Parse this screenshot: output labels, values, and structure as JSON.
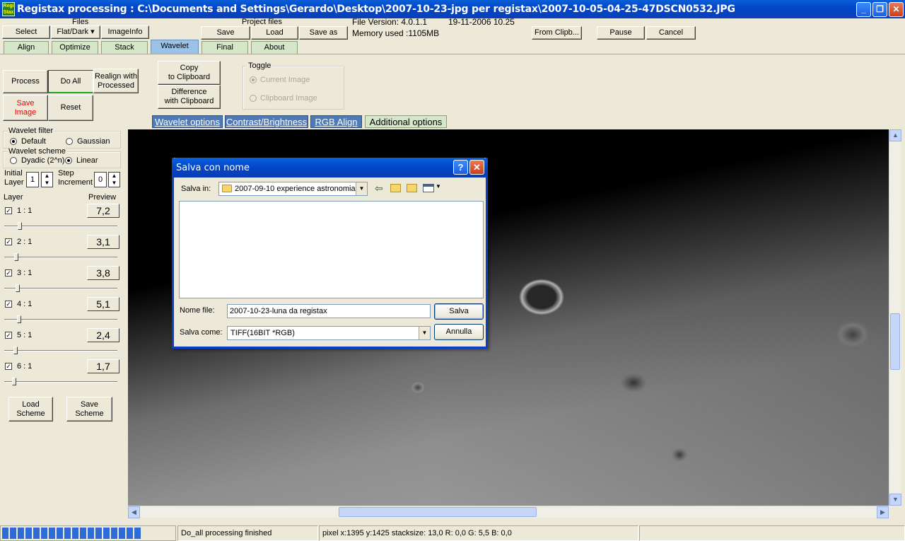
{
  "window": {
    "title": "Registax processing : C:\\Documents and Settings\\Gerardo\\Desktop\\2007-10-23-jpg per registax\\2007-10-05-04-25-47DSCN0532.JPG",
    "logo_text": "Regi Stax"
  },
  "toolbar": {
    "files_label": "Files",
    "select": "Select",
    "flatdark": "Flat/Dark ▾",
    "imageinfo": "ImageInfo",
    "project_files_label": "Project files",
    "save": "Save",
    "load": "Load",
    "save_as": "Save as",
    "file_version": "File Version: 4.0.1.1",
    "date": "19-11-2006 10.25",
    "memory": "Memory used :1105MB",
    "from_clip": "From Clipb...",
    "pause": "Pause",
    "cancel": "Cancel"
  },
  "tabs": [
    {
      "label": "Align"
    },
    {
      "label": "Optimize"
    },
    {
      "label": "Stack"
    },
    {
      "label": "Wavelet"
    },
    {
      "label": "Final"
    },
    {
      "label": "About"
    }
  ],
  "left_panel": {
    "process": "Process",
    "do_all": "Do All",
    "realign_1": "Realign with",
    "realign_2": "Processed",
    "save_image_1": "Save",
    "save_image_2": "Image",
    "reset": "Reset",
    "wavelet_filter": "Wavelet filter",
    "default": "Default",
    "gaussian": "Gaussian",
    "wavelet_scheme": "Wavelet scheme",
    "dyadic": "Dyadic (2^n)",
    "linear": "Linear",
    "initial_1": "Initial",
    "initial_2": "Layer",
    "initial_value": "1",
    "step_1": "Step",
    "step_2": "Increment",
    "step_value": "0",
    "layer_label": "Layer",
    "preview_label": "Preview",
    "layers": [
      {
        "label": "1 : 1",
        "value": "7,2",
        "slider": 0.12
      },
      {
        "label": "2 : 1",
        "value": "3,1",
        "slider": 0.09
      },
      {
        "label": "3 : 1",
        "value": "3,8",
        "slider": 0.1
      },
      {
        "label": "4 : 1",
        "value": "5,1",
        "slider": 0.11
      },
      {
        "label": "5 : 1",
        "value": "2,4",
        "slider": 0.08
      },
      {
        "label": "6 : 1",
        "value": "1,7",
        "slider": 0.07
      }
    ],
    "load_scheme_1": "Load",
    "load_scheme_2": "Scheme",
    "save_scheme_1": "Save",
    "save_scheme_2": "Scheme"
  },
  "wavelet_top": {
    "copy_1": "Copy",
    "copy_2": "to Clipboard",
    "diff_1": "Difference",
    "diff_2": "with Clipboard",
    "toggle": "Toggle",
    "current_image": "Current Image",
    "clipboard_image": "Clipboard Image"
  },
  "subtabs": [
    {
      "label": "Wavelet options"
    },
    {
      "label": "Contrast/Brightness"
    },
    {
      "label": "RGB Align"
    },
    {
      "label": "Additional options"
    }
  ],
  "dialog": {
    "title": "Salva con nome",
    "help": "?",
    "close": "✕",
    "salva_in_label": "Salva in:",
    "salva_in_value": "2007-09-10 experience astronomia",
    "nome_file_label": "Nome file:",
    "nome_file_value": "2007-10-23-luna da registax",
    "salva_come_label": "Salva come:",
    "salva_come_value": "TIFF(16BIT *RGB)",
    "salva_btn": "Salva",
    "annulla_btn": "Annulla"
  },
  "status": {
    "progress_blocks": 18,
    "message": "Do_all processing finished",
    "pixel_info": "pixel x:1395 y:1425 stacksize: 13,0 R: 0,0 G: 5,5 B: 0,0"
  }
}
